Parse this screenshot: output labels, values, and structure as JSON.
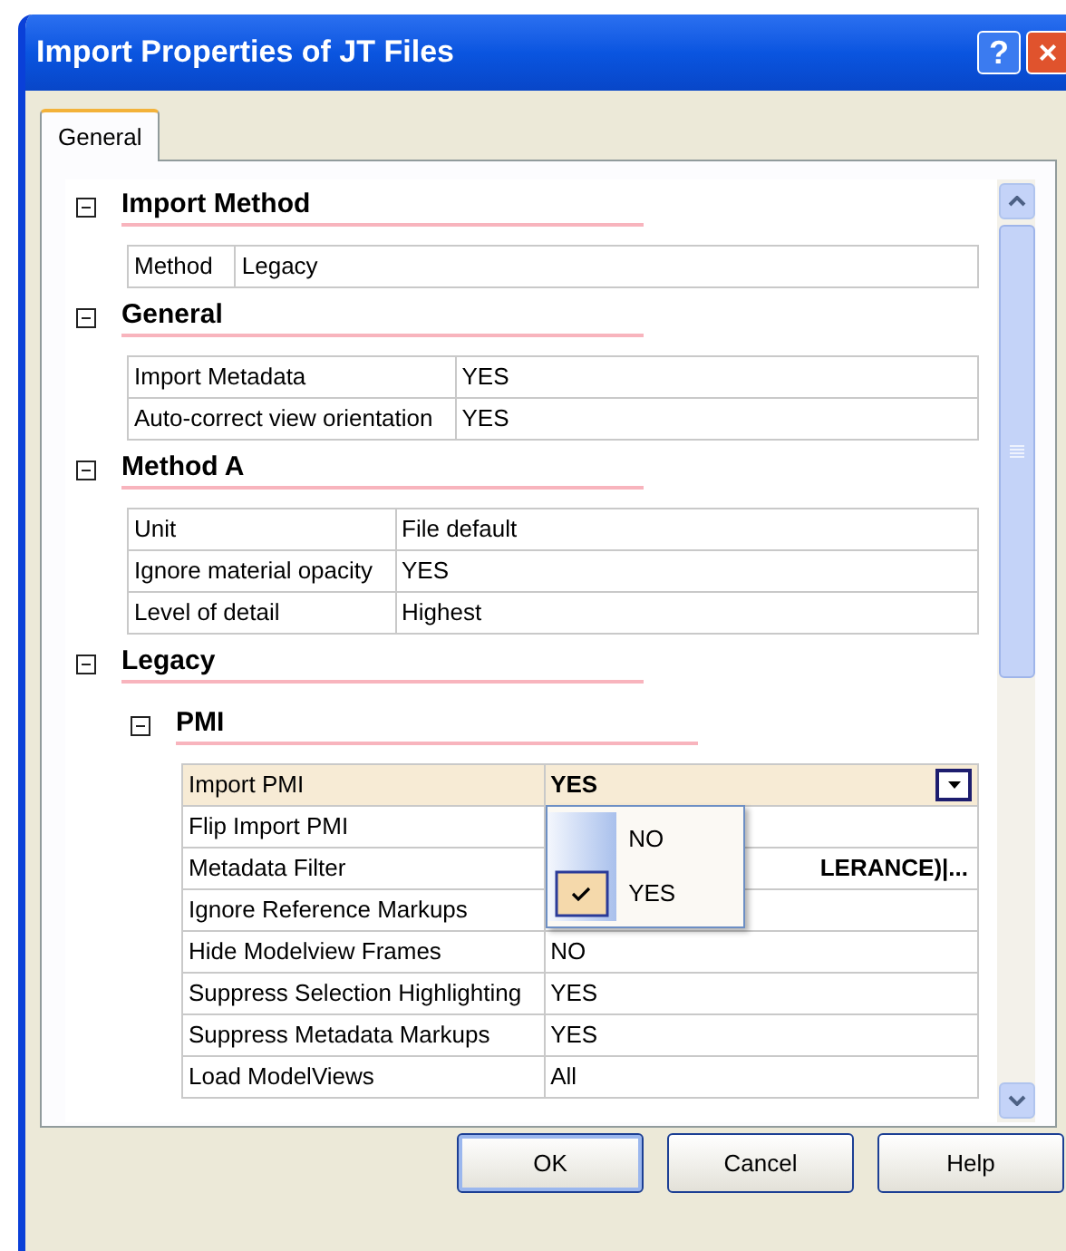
{
  "window": {
    "title": "Import Properties of JT Files"
  },
  "title_buttons": [
    {
      "label": "?",
      "kind": "help"
    },
    {
      "label": "×",
      "kind": "close"
    }
  ],
  "tabs": [
    {
      "label": "General",
      "selected": true
    }
  ],
  "sections": [
    {
      "title": "Import Method",
      "expanded": true,
      "rows": [
        {
          "label": "Method",
          "value": "Legacy",
          "selected": false
        }
      ]
    },
    {
      "title": "General",
      "expanded": true,
      "rows": [
        {
          "label": "Import Metadata",
          "value": "YES",
          "selected": false
        },
        {
          "label": "Auto-correct view orientation",
          "value": "YES",
          "selected": false
        }
      ]
    },
    {
      "title": "Method A",
      "expanded": true,
      "rows": [
        {
          "label": "Unit",
          "value": "File default",
          "selected": false
        },
        {
          "label": "Ignore material opacity",
          "value": "YES",
          "selected": false
        },
        {
          "label": "Level of detail",
          "value": "Highest",
          "selected": false
        }
      ]
    },
    {
      "title": "Legacy",
      "expanded": true,
      "children": [
        {
          "title": "PMI",
          "expanded": true,
          "rows": [
            {
              "label": "Import PMI",
              "value": "YES",
              "selected": true,
              "dropdown": {
                "open": true,
                "options": [
                  {
                    "label": "NO",
                    "selected": false
                  },
                  {
                    "label": "YES",
                    "selected": true
                  }
                ]
              }
            },
            {
              "label": "Flip Import PMI",
              "selected": false
            },
            {
              "label": "Metadata Filter",
              "value": "LERANCE)|...",
              "bold": true,
              "selected": false
            },
            {
              "label": "Ignore Reference Markups",
              "selected": false
            },
            {
              "label": "Hide Modelview Frames",
              "value": "NO",
              "selected": false
            },
            {
              "label": "Suppress Selection Highlighting",
              "value": "YES",
              "selected": false
            },
            {
              "label": "Suppress Metadata Markups",
              "value": "YES",
              "selected": false
            },
            {
              "label": "Load ModelViews",
              "value": "All",
              "selected": false
            }
          ]
        }
      ]
    }
  ],
  "buttons": [
    {
      "label": "OK",
      "default": true
    },
    {
      "label": "Cancel",
      "default": false
    },
    {
      "label": "Help",
      "default": false
    }
  ]
}
